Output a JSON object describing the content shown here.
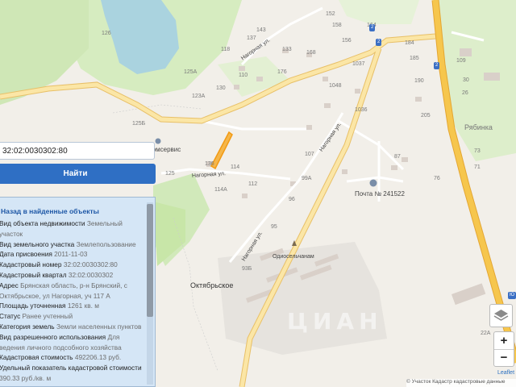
{
  "search": {
    "value": "32:02:0030302:80"
  },
  "find_button": {
    "label": "Найти"
  },
  "results": {
    "back_label": "Назад в найденные объекты",
    "rows": [
      {
        "k": "Вид объекта недвижимости",
        "v": "Земельный"
      },
      {
        "k": "",
        "v": "участок"
      },
      {
        "k": "Вид земельного участка",
        "v": "Землепользование"
      },
      {
        "k": "Дата присвоения",
        "v": "2011-11-03"
      },
      {
        "k": "Кадастровый номер",
        "v": "32:02:0030302:80"
      },
      {
        "k": "Кадастровый квартал",
        "v": "32:02:0030302"
      },
      {
        "k": "Адрес",
        "v": "Брянская область, р-н Брянский, с"
      },
      {
        "k": "",
        "v": "Октябрьское, ул Нагорная, уч 117 А"
      },
      {
        "k": "Площадь уточненная",
        "v": "1261 кв. м"
      },
      {
        "k": "Статус",
        "v": "Ранее учтенный"
      },
      {
        "k": "Категория земель",
        "v": "Земли населенных пунктов"
      },
      {
        "k": "Вид разрешенного использования",
        "v": "Для"
      },
      {
        "k": "",
        "v": "ведения личного подсобного хозяйства"
      },
      {
        "k": "Кадастровая стоимость",
        "v": "492206.13 руб."
      },
      {
        "k": "Удельный показатель кадастровой стоимости",
        "v": ""
      },
      {
        "k": "",
        "v": "390.33 руб./кв. м"
      }
    ]
  },
  "map": {
    "places": [
      "Октябрьское",
      "Рябинка"
    ],
    "streets": [
      "Нагорная ул.",
      "Нагорная ул.",
      "Нагорная ул.",
      "Нагорная ул.",
      "Одиосельчанам"
    ],
    "poi": [
      "Почта № 241522",
      "Агромсервис"
    ],
    "road_shields": [
      "2",
      "2",
      "2",
      "Ю"
    ],
    "house_numbers": [
      "126",
      "137",
      "152",
      "118",
      "133",
      "125А",
      "130",
      "176",
      "123А",
      "114",
      "1037",
      "1048",
      "1036",
      "107",
      "99А",
      "112",
      "114А",
      "125Б",
      "125",
      "96",
      "95",
      "93Б",
      "136",
      "184",
      "185",
      "156",
      "158",
      "190",
      "205",
      "87",
      "76",
      "73",
      "71",
      "22А",
      "30",
      "26",
      "143",
      "168",
      "164",
      "110",
      "109"
    ]
  },
  "controls": {
    "layers_icon": "layers-icon",
    "zoom_in": "+",
    "zoom_out": "−",
    "leaflet": "Leaflet",
    "attribution": "© Участок Кадастр  кадастровые данные"
  },
  "watermark": "ЦИАН",
  "colors": {
    "road": "#f7dd8a",
    "highway": "#f6c64d",
    "water": "#aad3df",
    "forest": "#c8e6a8",
    "parcel": "#f5a623",
    "button": "#2f6fc4",
    "panel": "#d5e6f6"
  }
}
